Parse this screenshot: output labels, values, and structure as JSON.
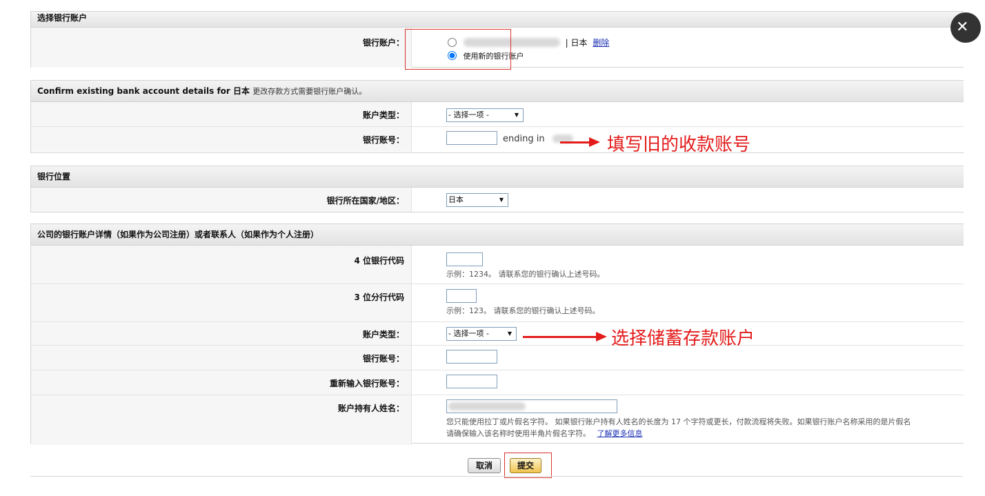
{
  "section_account": {
    "title": "选择银行账户",
    "label": "银行账户：",
    "existing_option_suffix": "| 日本",
    "delete_link": "删除",
    "new_option_label": "使用新的银行账户"
  },
  "section_confirm": {
    "title": "Confirm existing bank account details for 日本",
    "hint": "更改存款方式需要银行账户确认。",
    "account_type_label": "账户类型：",
    "account_type_value": "- 选择一项 -",
    "account_number_label": "银行账号：",
    "ending_text": "ending in",
    "annotation": "填写旧的收款账号"
  },
  "section_location": {
    "title": "银行位置",
    "country_label": "银行所在国家/地区：",
    "country_value": "日本"
  },
  "section_details": {
    "title": "公司的银行账户详情（如果作为公司注册）或者联系人（如果作为个人注册）",
    "bank_code_label": "4 位银行代码",
    "bank_code_help": "示例：1234。 请联系您的银行确认上述号码。",
    "branch_code_label": "3 位分行代码",
    "branch_code_help": "示例：123。 请联系您的银行确认上述号码。",
    "account_type_label": "账户类型：",
    "account_type_value": "- 选择一项 -",
    "account_type_annotation": "选择储蓄存款账户",
    "account_number_label": "银行账号：",
    "reenter_label": "重新输入银行账号：",
    "holder_label": "账户持有人姓名：",
    "holder_help_line1": "您只能使用拉丁或片假名字符。 如果银行账户持有人姓名的长度为 17 个字符或更长，付款流程将失败。如果银行账户名称采用的是片假名",
    "holder_help_line2": "请确保输入该名称时使用半角片假名字符。",
    "learn_more": "了解更多信息"
  },
  "actions": {
    "cancel": "取消",
    "submit": "提交"
  }
}
